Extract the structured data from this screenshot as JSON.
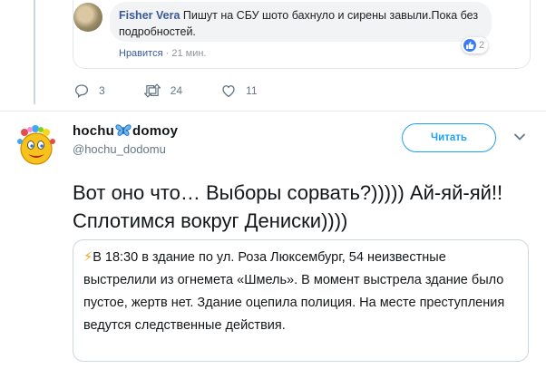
{
  "facebook_comment": {
    "author": "Fisher Vera",
    "text": "Пишут на СБУ шото бахнуло и сирены завыли.Пока без подробностей.",
    "like_label": "Нравится",
    "separator": "·",
    "time": "21 мин.",
    "reaction_count": "2"
  },
  "parent_actions": {
    "replies": "3",
    "retweets": "24",
    "likes": "11"
  },
  "tweet": {
    "display_name_part1": "hochu",
    "display_name_part2": "domoy",
    "handle": "@hochu_dodomu",
    "follow_label": "Читать",
    "text": "Вот оно что… Выборы сорвать?))))) Ай-яй-яй!! Сплотимся вокруг Дениски))))"
  },
  "quoted": {
    "bolt": "⚡",
    "text": "В 18:30 в здание по ул. Роза Люксембург, 54 неизвестные выстрелили из огнемета «Шмель». В момент выстрела здание было пустое, жертв нет. Здание оцепила полиция. На месте преступления ведутся следственные действия."
  },
  "colors": {
    "twitter_blue": "#1da1f2",
    "facebook_blue": "#385898",
    "muted": "#657786",
    "border": "#ccd6dd"
  },
  "icons": [
    "reply-icon",
    "retweet-icon",
    "heart-icon",
    "like-reaction-icon",
    "butterfly-icon",
    "chevron-down-icon",
    "lightning-icon"
  ]
}
